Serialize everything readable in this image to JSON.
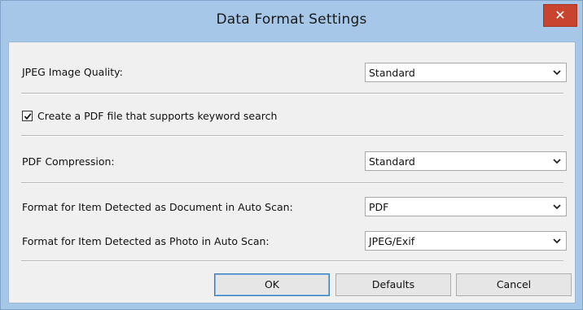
{
  "window": {
    "title": "Data Format Settings",
    "close_glyph": "✕"
  },
  "settings": {
    "jpeg_quality": {
      "label": "JPEG Image Quality:",
      "value": "Standard"
    },
    "keyword_search": {
      "label": "Create a PDF file that supports keyword search",
      "checked": true
    },
    "pdf_compression": {
      "label": "PDF Compression:",
      "value": "Standard"
    },
    "document_format": {
      "label": "Format for Item Detected as Document in Auto Scan:",
      "value": "PDF"
    },
    "photo_format": {
      "label": "Format for Item Detected as Photo in Auto Scan:",
      "value": "JPEG/Exif"
    }
  },
  "buttons": {
    "ok": "OK",
    "defaults": "Defaults",
    "cancel": "Cancel"
  },
  "icons": {
    "close": "close-icon",
    "dropdown": "chevron-down-icon",
    "check": "check-icon"
  },
  "colors": {
    "title_bar": "#a6c7e8",
    "close_button": "#c9442f",
    "client_background": "#f0f0f0",
    "default_button_border": "#3c7fb1"
  }
}
